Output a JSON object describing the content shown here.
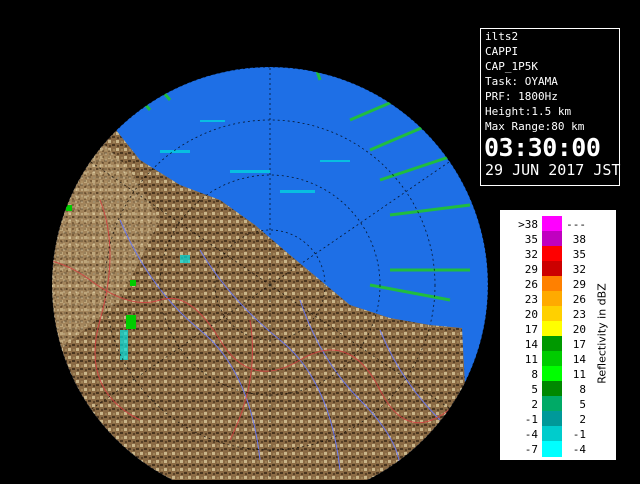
{
  "info": {
    "station": "ilts2",
    "product": "CAPPI",
    "product_code": "CAP_1P5K",
    "task": "Task: OYAMA",
    "prf": "PRF: 1800Hz",
    "height": "Height:1.5 km",
    "max_range": "Max Range:80 km",
    "time": "03:30:00",
    "date": "29 JUN 2017 JST"
  },
  "legend": {
    "unit_label": "Reflectivity in dBZ",
    "rows": [
      {
        "low": ">38",
        "high": "---",
        "color": "#ff00ff"
      },
      {
        "low": "35",
        "high": "38",
        "color": "#c000c0"
      },
      {
        "low": "32",
        "high": "35",
        "color": "#ff0000"
      },
      {
        "low": "29",
        "high": "32",
        "color": "#cc0000"
      },
      {
        "low": "26",
        "high": "29",
        "color": "#ff8000"
      },
      {
        "low": "23",
        "high": "26",
        "color": "#ffaa00"
      },
      {
        "low": "20",
        "high": "23",
        "color": "#ffd000"
      },
      {
        "low": "17",
        "high": "20",
        "color": "#ffff00"
      },
      {
        "low": "14",
        "high": "17",
        "color": "#009900"
      },
      {
        "low": "11",
        "high": "14",
        "color": "#00cc00"
      },
      {
        "low": "8",
        "high": "11",
        "color": "#00ff00"
      },
      {
        "low": "5",
        "high": "8",
        "color": "#008800"
      },
      {
        "low": "2",
        "high": "5",
        "color": "#00aa66"
      },
      {
        "low": "-1",
        "high": "2",
        "color": "#009999"
      },
      {
        "low": "-4",
        "high": "-1",
        "color": "#00cccc"
      },
      {
        "low": "-7",
        "high": "-4",
        "color": "#00ffff"
      }
    ]
  },
  "colors": {
    "sea": "#1e6fe6",
    "radar_echo_weak": "#00e0e0",
    "radar_echo_moderate": "#22cc22",
    "land": "#8a6a44",
    "rivers": "#6a7bff",
    "borders": "#d04040"
  }
}
